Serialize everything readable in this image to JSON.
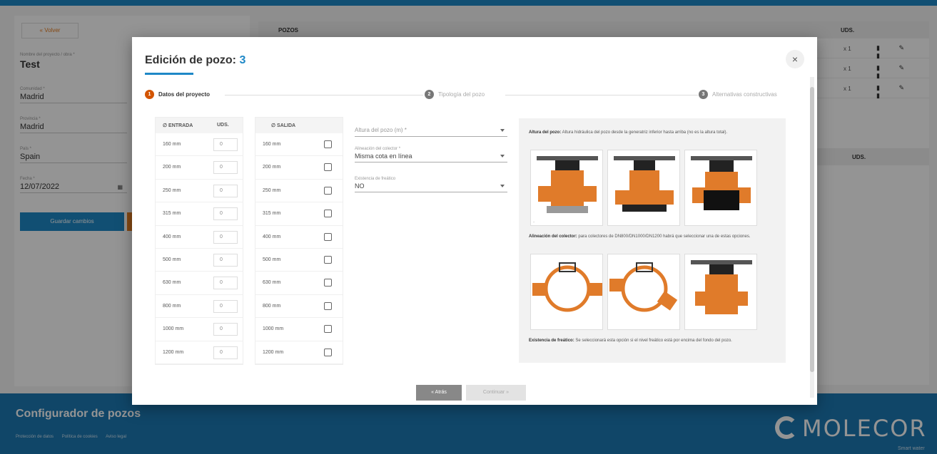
{
  "background": {
    "back_label": "« Volver",
    "project_name_label": "Nombre del proyecto / obra *",
    "project_name": "Test",
    "community_label": "Comunidad *",
    "community": "Madrid",
    "province_label": "Provincia *",
    "province": "Madrid",
    "country_label": "País *",
    "country": "Spain",
    "date_label": "Fecha *",
    "date": "12/07/2022",
    "save_label": "Guardar cambios",
    "table_header_pozos": "POZOS",
    "table_header_uds": "UDS.",
    "rows": [
      {
        "qty": "x 1",
        "actions": "▮ ✎ ▮"
      },
      {
        "qty": "x 1",
        "actions": "▮ ✎ ▮"
      },
      {
        "qty": "x 1",
        "actions": "▮ ✎ ▮"
      }
    ],
    "table2_header_uds": "UDS."
  },
  "footer": {
    "title": "Configurador de pozos",
    "links": [
      "Protección de datos",
      "Política de cookies",
      "Aviso legal"
    ],
    "logo_text": "MOLECOR",
    "tagline": "Smart water"
  },
  "modal": {
    "title": "Edición de pozo:",
    "pozo_number": "3",
    "close_label": "×",
    "steps": [
      {
        "num": "1",
        "label": "Datos del proyecto"
      },
      {
        "num": "2",
        "label": "Tipología del pozo"
      },
      {
        "num": "3",
        "label": "Alternativas constructivas"
      }
    ],
    "entrada": {
      "header": "∅ ENTRADA",
      "uds_header": "UDS.",
      "rows": [
        {
          "size": "160 mm",
          "qty": "0"
        },
        {
          "size": "200 mm",
          "qty": "0"
        },
        {
          "size": "250 mm",
          "qty": "0"
        },
        {
          "size": "315 mm",
          "qty": "0"
        },
        {
          "size": "400 mm",
          "qty": "0"
        },
        {
          "size": "500 mm",
          "qty": "0"
        },
        {
          "size": "630 mm",
          "qty": "0"
        },
        {
          "size": "800 mm",
          "qty": "0"
        },
        {
          "size": "1000 mm",
          "qty": "0"
        },
        {
          "size": "1200 mm",
          "qty": "0"
        }
      ]
    },
    "salida": {
      "header": "∅ SALIDA",
      "rows": [
        {
          "size": "160 mm"
        },
        {
          "size": "200 mm"
        },
        {
          "size": "250 mm"
        },
        {
          "size": "315 mm"
        },
        {
          "size": "400 mm"
        },
        {
          "size": "500 mm"
        },
        {
          "size": "630 mm"
        },
        {
          "size": "800 mm"
        },
        {
          "size": "1000 mm"
        },
        {
          "size": "1200 mm"
        }
      ]
    },
    "form": {
      "altura_placeholder": "Altura del pozo (m) *",
      "alineacion_label": "Alineación del colector *",
      "alineacion_value": "Misma cota en línea",
      "freatico_label": "Existencia de freático",
      "freatico_value": "NO"
    },
    "help": {
      "altura_title": "Altura del pozo:",
      "altura_text": " Altura hidráulica del pozo desde la generatriz inferior hasta arriba (no es la altura total).",
      "alineacion_title": "Alineación del colector:",
      "alineacion_text": " para colectores de DN800/DN1000/DN1200 habrá que seleccionar una de estas opciones.",
      "freatico_title": "Existencia de freático:",
      "freatico_text": " Se seleccionará esta opción si el nivel freático está por encima del fondo del pozo."
    },
    "buttons": {
      "back": "« Atrás",
      "next": "Continuar »"
    }
  },
  "colors": {
    "accent": "#1e88c7",
    "step_active": "#d35400",
    "pipe_orange": "#e07b2a",
    "footer": "#1c79b3"
  }
}
